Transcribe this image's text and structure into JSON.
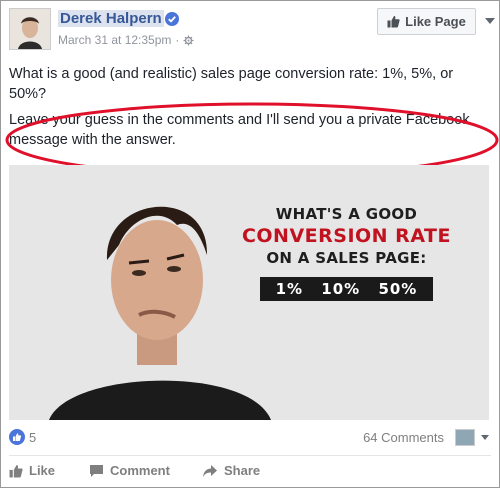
{
  "header": {
    "author": "Derek Halpern",
    "timestamp": "March 31 at 12:35pm",
    "separator": "·",
    "like_page_label": "Like Page"
  },
  "post": {
    "paragraph1": "What is a good (and realistic) sales page conversion rate: 1%, 5%, or 50%?",
    "paragraph2": "Leave your guess in the comments and I'll send you a private Facebook message with the answer."
  },
  "image": {
    "line1": "WHAT'S A GOOD",
    "line2": "CONVERSION RATE",
    "line3": "ON A SALES PAGE:",
    "options": [
      "1%",
      "10%",
      "50%"
    ]
  },
  "stats": {
    "like_count": "5",
    "comments_label": "64 Comments"
  },
  "actions": {
    "like": "Like",
    "comment": "Comment",
    "share": "Share"
  },
  "colors": {
    "link": "#365899",
    "highlight_circle": "#e0102a",
    "accent_red": "#c1121f",
    "like_blue": "#4c75d9"
  }
}
